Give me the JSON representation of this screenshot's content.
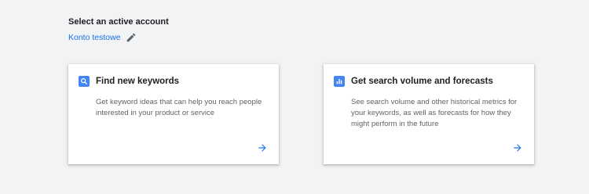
{
  "account_section": {
    "heading": "Select an active account",
    "account_name": "Konto testowe",
    "edit_icon": "pencil-icon"
  },
  "cards": [
    {
      "icon": "search-icon",
      "title": "Find new keywords",
      "description": "Get keyword ideas that can help you reach people interested in your product or service",
      "arrow_icon": "arrow-right-icon"
    },
    {
      "icon": "bar-chart-icon",
      "title": "Get search volume and forecasts",
      "description": "See search volume and other historical metrics for your keywords, as well as forecasts for how they might perform in the future",
      "arrow_icon": "arrow-right-icon"
    }
  ],
  "colors": {
    "background": "#f1f3f4",
    "accent": "#1a73e8",
    "icon_bg": "#4285f4",
    "title": "#202124",
    "body_text": "#5f6368",
    "edit_icon": "#5f6368"
  }
}
